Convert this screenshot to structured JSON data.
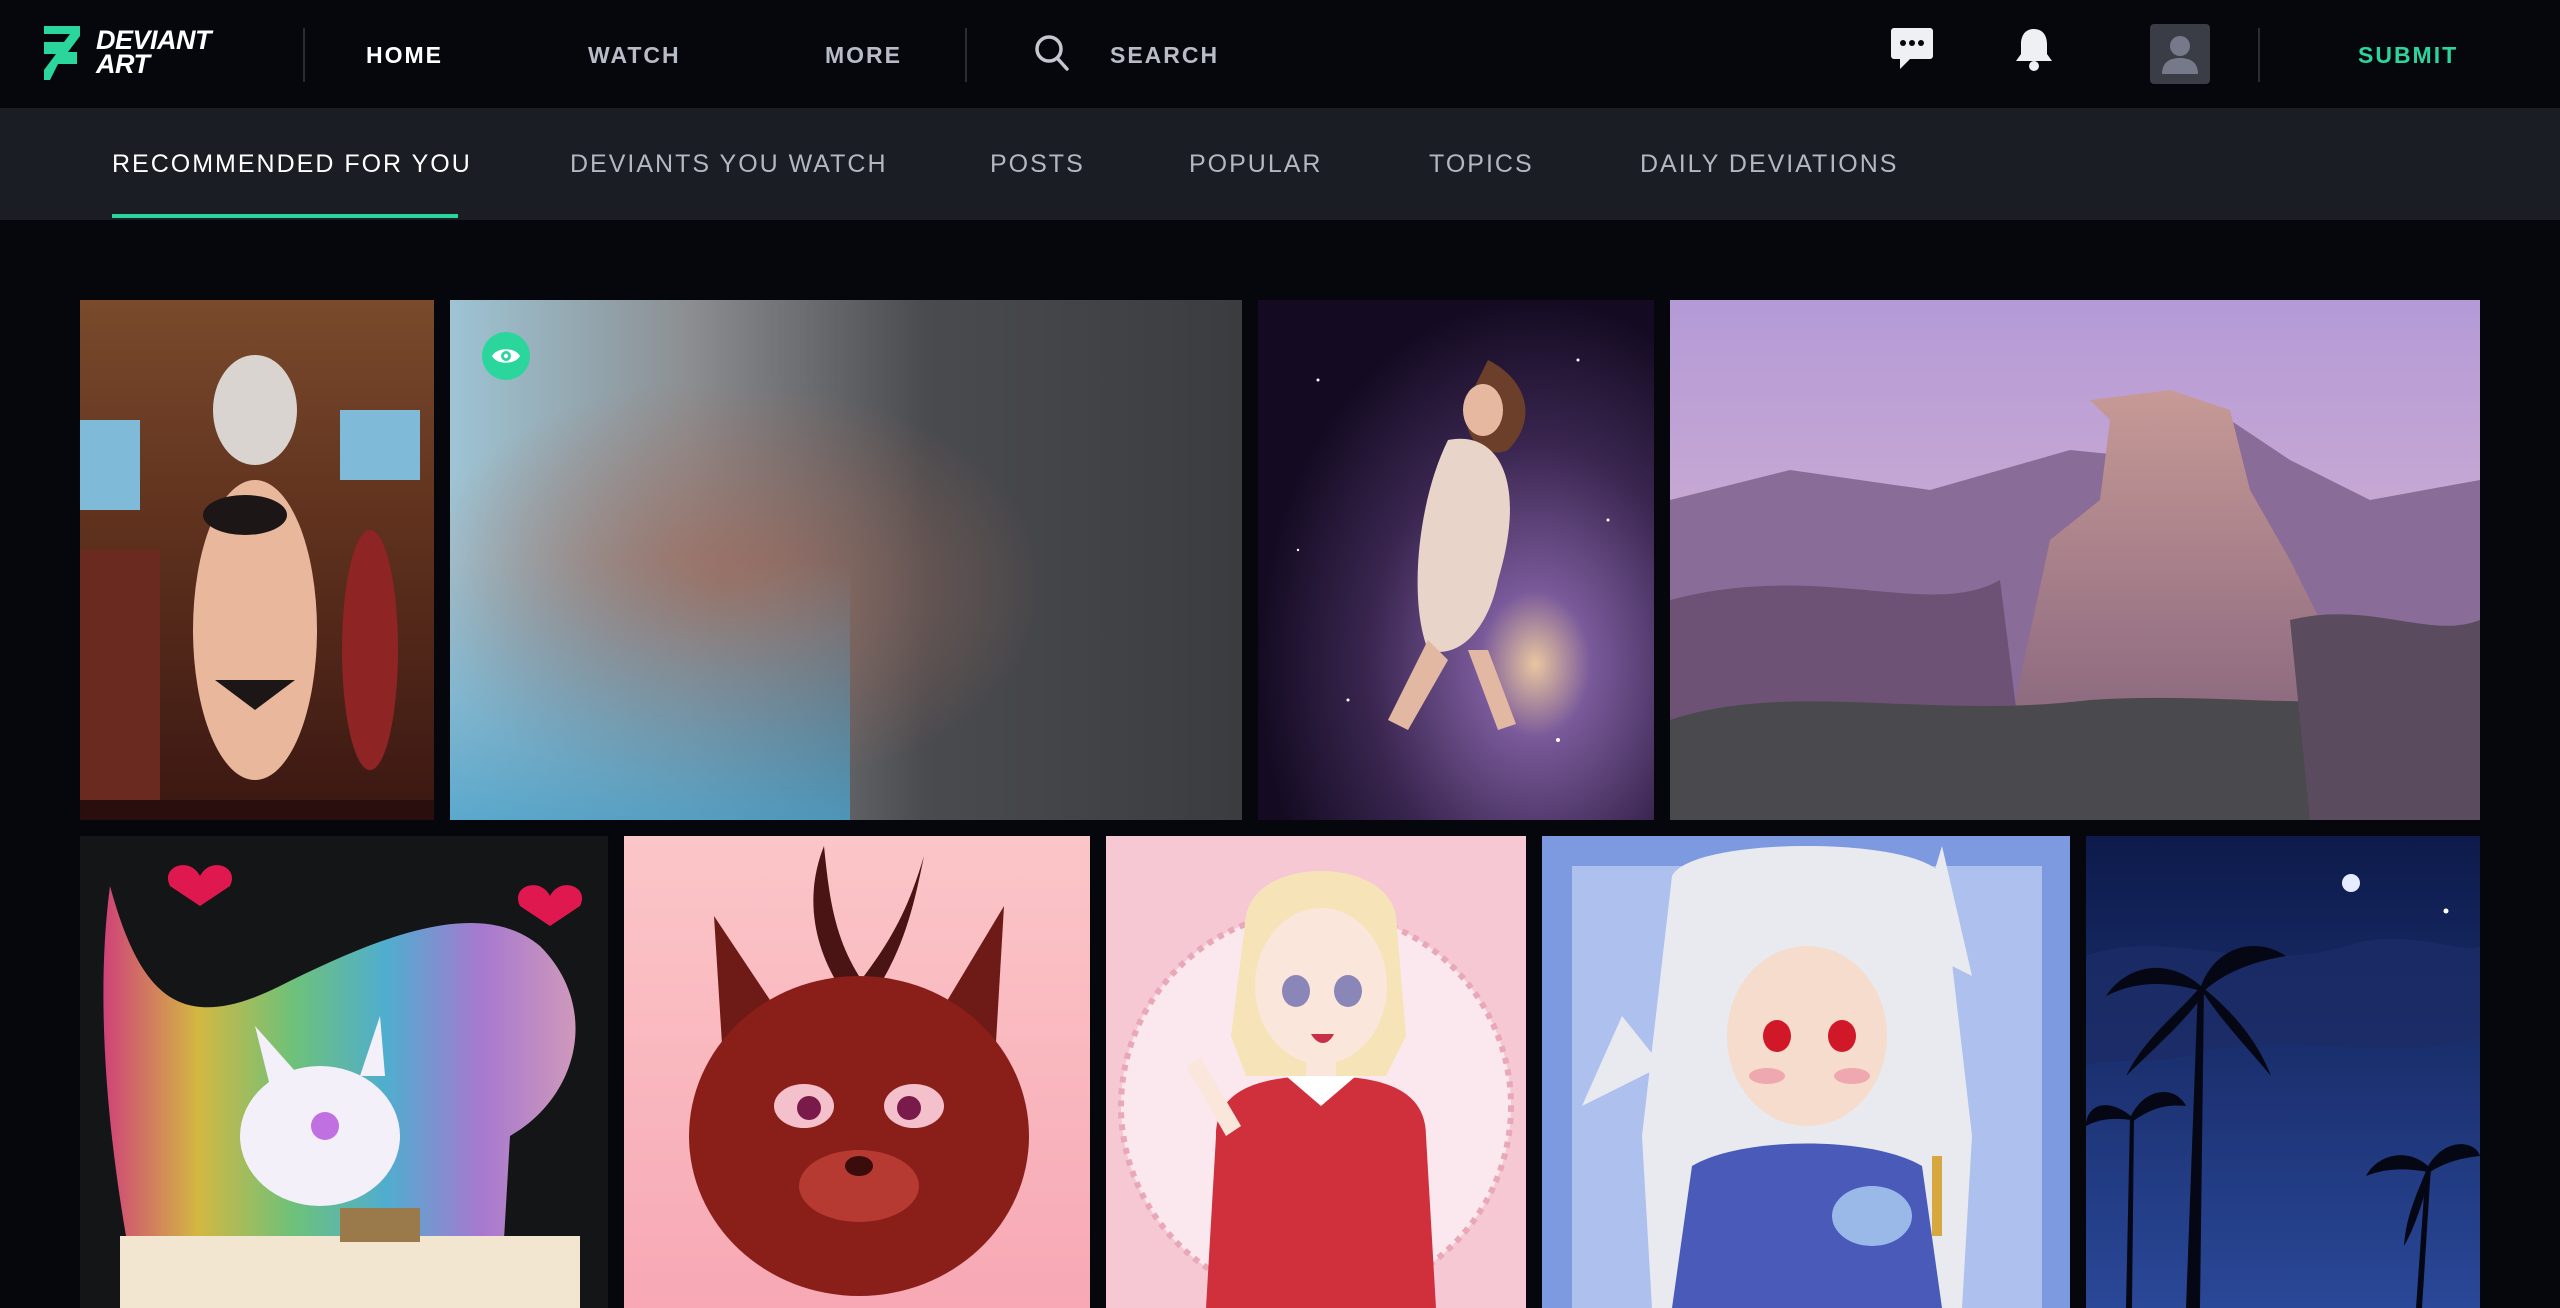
{
  "brand": {
    "logo_line1": "DEVIANT",
    "logo_line2": "ART"
  },
  "nav": {
    "home": "HOME",
    "watch": "WATCH",
    "more": "MORE"
  },
  "search": {
    "label": "SEARCH"
  },
  "header": {
    "submit": "SUBMIT"
  },
  "tabs": [
    {
      "label": "RECOMMENDED FOR YOU"
    },
    {
      "label": "DEVIANTS YOU WATCH"
    },
    {
      "label": "POSTS"
    },
    {
      "label": "POPULAR"
    },
    {
      "label": "TOPICS"
    },
    {
      "label": "DAILY DEVIATIONS"
    }
  ],
  "gallery": [
    {
      "subject": "pin-up-character-bar"
    },
    {
      "subject": "blurred-mature-content"
    },
    {
      "subject": "cosmic-woman-floating"
    },
    {
      "subject": "half-dome-mountain-landscape"
    },
    {
      "subject": "rainbow-fox-creature"
    },
    {
      "subject": "red-horned-furry-character"
    },
    {
      "subject": "blonde-anime-girl-red-sweater"
    },
    {
      "subject": "silver-haired-anime-girl-tea"
    },
    {
      "subject": "palm-trees-night-sky"
    }
  ],
  "colors": {
    "accent": "#2bd69c",
    "background": "#06070d",
    "tabbar": "#1a1d24"
  }
}
